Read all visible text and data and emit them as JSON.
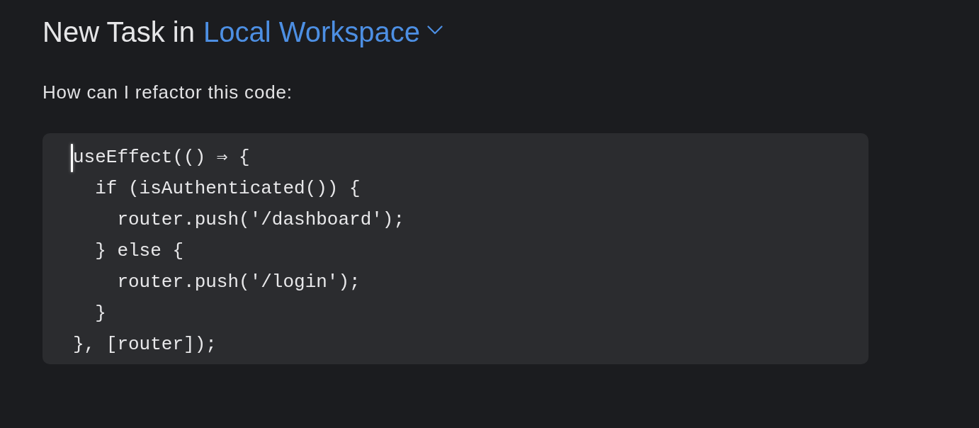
{
  "heading": {
    "prefix": "New Task in",
    "workspace": "Local Workspace"
  },
  "prompt": {
    "text": "How can I refactor this code:",
    "focused": true,
    "code": [
      "useEffect(() ⇒ {",
      "  if (isAuthenticated()) {",
      "    router.push('/dashboard');",
      "  } else {",
      "    router.push('/login');",
      "  }",
      "}, [router]);"
    ]
  }
}
